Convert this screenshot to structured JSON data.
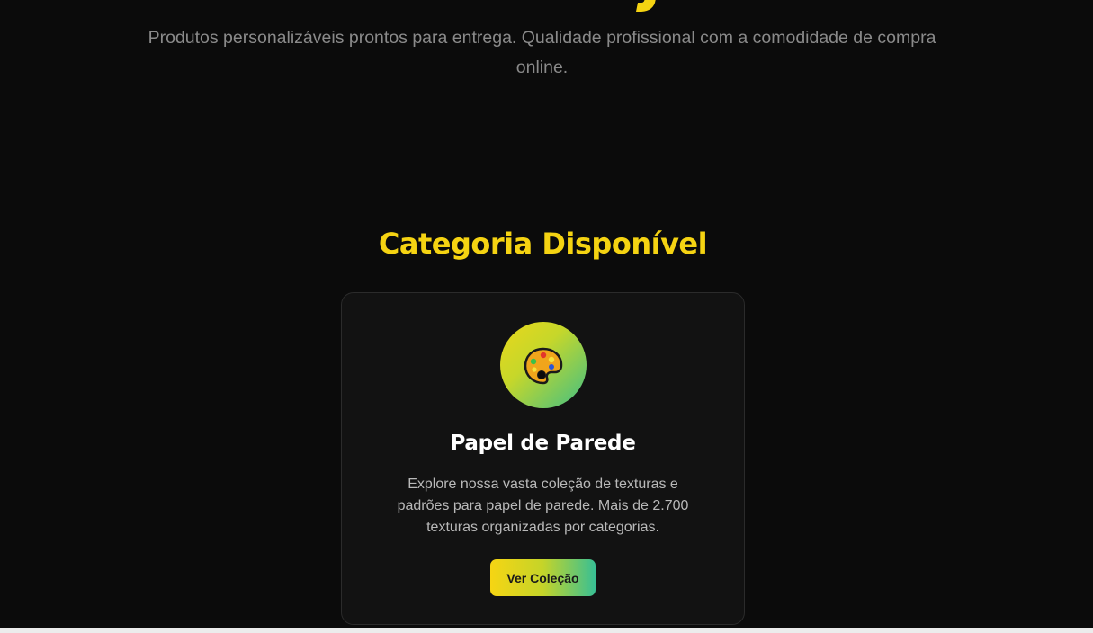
{
  "hero": {
    "subtitle": "Produtos personalizáveis prontos para entrega. Qualidade profissional com a comodidade de compra online."
  },
  "colors": {
    "background": "#0b0b0b",
    "accent_yellow": "#f5d312",
    "accent_teal": "#38bf94",
    "card_background": "#121212"
  },
  "section": {
    "title": "Categoria Disponível"
  },
  "category_card": {
    "icon": "artist-palette-icon",
    "title": "Papel de Parede",
    "description": "Explore nossa vasta coleção de texturas e padrões para papel de parede. Mais de 2.700 texturas organizadas por categorias.",
    "button_label": "Ver Coleção"
  }
}
